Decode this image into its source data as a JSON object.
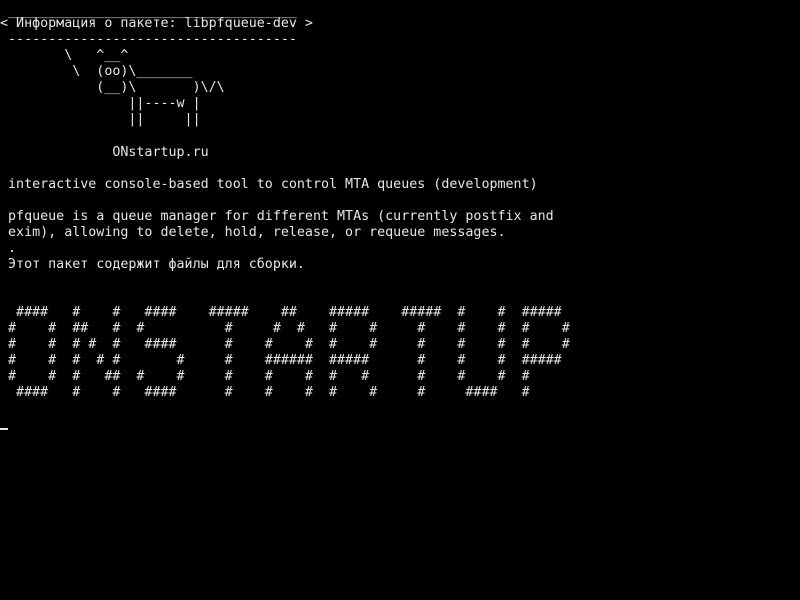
{
  "terminal": {
    "background": "#000000",
    "foreground": "#e6e6e6",
    "cowsay": {
      "border_top": " ____________________________________",
      "message": "< Информация о пакете: libpfqueue-dev >",
      "border_bottom": " ------------------------------------",
      "cow": [
        "        \\   ^__^",
        "         \\  (oo)\\_______",
        "            (__)\\       )\\/\\",
        "                ||----w |",
        "                ||     ||"
      ],
      "site": "              ONstartup.ru"
    },
    "package": {
      "summary": " interactive console-based tool to control MTA queues (development)",
      "description": [
        " pfqueue is a queue manager for different MTAs (currently postfix and",
        " exim), allowing to delete, hold, release, or requeue messages.",
        " .",
        " Этот пакет содержит файлы для сборки."
      ]
    },
    "banner": [
      "  ####   #    #   ####    #####    ##    #####    #####  #    #  #####",
      " #    #  ##   #  #          #     #  #   #    #     #    #    #  #    #",
      " #    #  # #  #   ####      #    #    #  #    #     #    #    #  #    #",
      " #    #  #  # #       #     #    ######  #####      #    #    #  #####",
      " #    #  #   ##  #    #     #    #    #  #   #      #    #    #  #",
      "  ####   #    #   ####      #    #    #  #    #     #     ####   #"
    ]
  }
}
